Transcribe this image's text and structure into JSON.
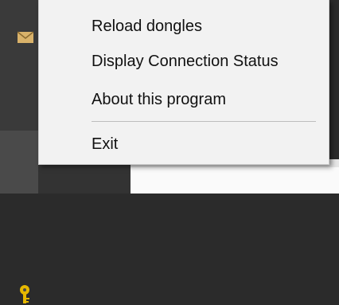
{
  "context_menu": {
    "items": [
      {
        "label": "Reload dongles"
      },
      {
        "label": "Display Connection Status"
      },
      {
        "label": "About this program"
      },
      {
        "label": "Exit"
      }
    ]
  },
  "taskbar": {
    "icons": [
      "mail-icon",
      "headset-icon",
      "key-icon"
    ]
  },
  "colors": {
    "menu_background": "#f2f2f2",
    "menu_text": "#111111",
    "separator": "#bdbdbd",
    "taskbar_background": "#3a3a3a",
    "key_icon": "#e6b800",
    "mail_icon": "#d9b26a"
  }
}
